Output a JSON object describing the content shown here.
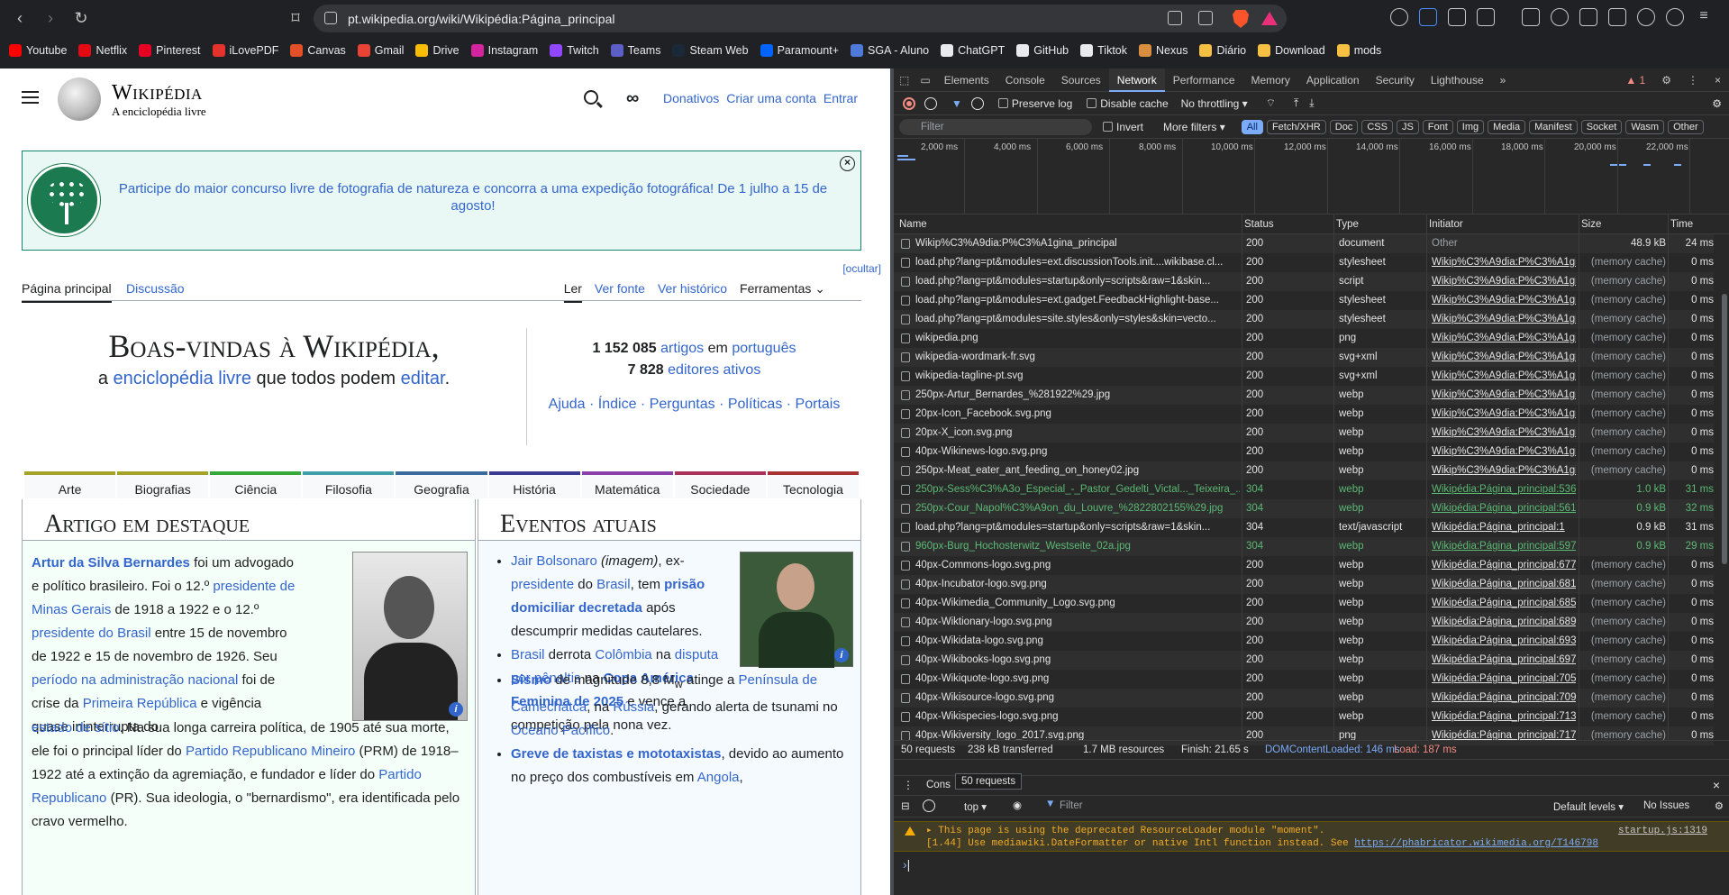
{
  "browser": {
    "url": "pt.wikipedia.org/wiki/Wikipédia:Página_principal",
    "bookmarks": [
      "Youtube",
      "Netflix",
      "Pinterest",
      "iLovePDF",
      "Canvas",
      "Gmail",
      "Drive",
      "Instagram",
      "Twitch",
      "Teams",
      "Steam Web",
      "Paramount+",
      "SGA - Aluno",
      "ChatGPT",
      "GitHub",
      "Tiktok",
      "Nexus",
      "Diário",
      "Download",
      "mods"
    ],
    "bookmark_colors": [
      "#ff0000",
      "#e50914",
      "#e60023",
      "#e5322d",
      "#e34f26",
      "#ea4335",
      "#fbbc04",
      "#d6249f",
      "#9146ff",
      "#5b5fc7",
      "#1b2838",
      "#0064ff",
      "#4f7ad9",
      "#e8eaed",
      "#e8eaed",
      "#e8eaed",
      "#d98f40",
      "#f6c043",
      "#f6c043",
      "#f6c043"
    ]
  },
  "wiki": {
    "wordmark": "Wikipédia",
    "tagline": "A enciclopédia livre",
    "header_links": [
      "Donativos",
      "Criar uma conta",
      "Entrar"
    ],
    "banner": "Participe do maior concurso livre de fotografia de natureza e concorra a uma expedição fotográfica! De 1 julho a 15 de agosto!",
    "hide": "[ocultar]",
    "tabs_left": [
      "Página principal",
      "Discussão"
    ],
    "tabs_right": [
      "Ler",
      "Ver fonte",
      "Ver histórico",
      "Ferramentas"
    ],
    "welcome_title": "Boas-vindas à Wikipédia,",
    "welcome_line": {
      "a": "a ",
      "b": "enciclopédia livre",
      "c": " que todos podem ",
      "d": "editar",
      "e": "."
    },
    "stats": {
      "articles_num": "1 152 085",
      "articles": "artigos",
      "em": "em",
      "lang": "português",
      "editors_num": "7 828",
      "editors": "editores ativos"
    },
    "help_links": "Ajuda · Índice · Perguntas · Políticas · Portais",
    "categories": [
      {
        "name": "Arte",
        "color": "#a3a427"
      },
      {
        "name": "Biografias",
        "color": "#a3a427"
      },
      {
        "name": "Ciência",
        "color": "#36a839"
      },
      {
        "name": "Filosofia",
        "color": "#3f9ea8"
      },
      {
        "name": "Geografia",
        "color": "#3a6b9c"
      },
      {
        "name": "História",
        "color": "#3b3a93"
      },
      {
        "name": "Matemática",
        "color": "#8b3fa8"
      },
      {
        "name": "Sociedade",
        "color": "#a8325a"
      },
      {
        "name": "Tecnologia",
        "color": "#a83232"
      }
    ],
    "featured": {
      "title": "Artigo em destaque",
      "p1": [
        {
          "t": "Artur da Silva Bernardes",
          "s": "lkb"
        },
        {
          "t": " foi um advogado e político brasileiro. Foi o 12.º "
        },
        {
          "t": "presidente de Minas Gerais",
          "s": "lk"
        },
        {
          "t": " de 1918 a 1922 e o 12.º "
        },
        {
          "t": "presidente do Brasil",
          "s": "lk"
        },
        {
          "t": " entre 15 de novembro de 1922 e 15 de novembro de 1926. Seu "
        },
        {
          "t": "período na administração nacional",
          "s": "lk"
        },
        {
          "t": " foi de crise da "
        },
        {
          "t": "Primeira República",
          "s": "lk"
        },
        {
          "t": " e vigência quase ininterrupta do"
        }
      ],
      "p2": [
        {
          "t": "estado de sítio",
          "s": "lk"
        },
        {
          "t": ". Na sua longa carreira política, de 1905 até sua morte, ele foi o principal líder do "
        },
        {
          "t": "Partido Republicano Mineiro",
          "s": "lk"
        },
        {
          "t": " (PRM) de 1918–1922 até a extinção da agremiação, e fundador e líder do "
        },
        {
          "t": "Partido Republicano",
          "s": "lk"
        },
        {
          "t": " (PR). Sua ideologia, o \"bernardismo\", era identificada pelo cravo vermelho."
        }
      ]
    },
    "events": {
      "title": "Eventos atuais",
      "items": [
        [
          {
            "t": "Jair Bolsonaro",
            "s": "lk"
          },
          {
            "t": " (imagem)",
            "s": "it"
          },
          {
            "t": ", ex-"
          },
          {
            "t": "presidente",
            "s": "lk"
          },
          {
            "t": " do "
          },
          {
            "t": "Brasil",
            "s": "lk"
          },
          {
            "t": ", tem "
          },
          {
            "t": "prisão domiciliar decretada",
            "s": "lkb"
          },
          {
            "t": " após descumprir medidas cautelares."
          }
        ],
        [
          {
            "t": "Brasil",
            "s": "lk"
          },
          {
            "t": " derrota "
          },
          {
            "t": "Colômbia",
            "s": "lk"
          },
          {
            "t": " na "
          },
          {
            "t": "disputa por pênaltis",
            "s": "lk"
          },
          {
            "t": " na "
          },
          {
            "t": "Copa América Feminina de 2025",
            "s": "lkb"
          },
          {
            "t": " e vence a competição pela nona vez."
          }
        ]
      ],
      "items2": [
        [
          {
            "t": "Sismo",
            "s": "lkb"
          },
          {
            "t": " de magnitude 8,8 M"
          },
          {
            "t": "w",
            "s": "sub"
          },
          {
            "t": " atinge a "
          },
          {
            "t": "Península de Camechátca",
            "s": "lk"
          },
          {
            "t": ", na "
          },
          {
            "t": "Rússia",
            "s": "lk"
          },
          {
            "t": ", gerando alerta de tsunami no "
          },
          {
            "t": "Oceano Pacífico",
            "s": "lk"
          },
          {
            "t": "."
          }
        ],
        [
          {
            "t": "Greve de taxistas e mototaxistas",
            "s": "lkb"
          },
          {
            "t": ", devido ao aumento no preço dos combustíveis em "
          },
          {
            "t": "Angola",
            "s": "lk"
          },
          {
            "t": ","
          }
        ]
      ]
    }
  },
  "devtools": {
    "tabs": [
      "Elements",
      "Console",
      "Sources",
      "Network",
      "Performance",
      "Memory",
      "Application",
      "Security",
      "Lighthouse"
    ],
    "issues_count": "1",
    "toolbar": {
      "preserve_log": "Preserve log",
      "disable_cache": "Disable cache",
      "throttling": "No throttling"
    },
    "filter": {
      "placeholder": "Filter",
      "invert": "Invert",
      "more_filters": "More filters"
    },
    "types": [
      "All",
      "Fetch/XHR",
      "Doc",
      "CSS",
      "JS",
      "Font",
      "Img",
      "Media",
      "Manifest",
      "Socket",
      "Wasm",
      "Other"
    ],
    "ticks": [
      "2,000 ms",
      "4,000 ms",
      "6,000 ms",
      "8,000 ms",
      "10,000 ms",
      "12,000 ms",
      "14,000 ms",
      "16,000 ms",
      "18,000 ms",
      "20,000 ms",
      "22,000 ms"
    ],
    "columns": [
      "Name",
      "Status",
      "Type",
      "Initiator",
      "Size",
      "Time"
    ],
    "rows": [
      [
        "Wikip%C3%A9dia:P%C3%A1gina_principal",
        "200",
        "document",
        "Other",
        "48.9 kB",
        "24 ms",
        ""
      ],
      [
        "load.php?lang=pt&modules=ext.discussionTools.init....wikibase.cl...",
        "200",
        "stylesheet",
        "Wikip%C3%A9dia:P%C3%A1gi",
        "(memory cache)",
        "0 ms",
        ""
      ],
      [
        "load.php?lang=pt&modules=startup&only=scripts&raw=1&skin...",
        "200",
        "script",
        "Wikip%C3%A9dia:P%C3%A1gi",
        "(memory cache)",
        "0 ms",
        ""
      ],
      [
        "load.php?lang=pt&modules=ext.gadget.FeedbackHighlight-base...",
        "200",
        "stylesheet",
        "Wikip%C3%A9dia:P%C3%A1gi",
        "(memory cache)",
        "0 ms",
        ""
      ],
      [
        "load.php?lang=pt&modules=site.styles&only=styles&skin=vecto...",
        "200",
        "stylesheet",
        "Wikip%C3%A9dia:P%C3%A1gi",
        "(memory cache)",
        "0 ms",
        ""
      ],
      [
        "wikipedia.png",
        "200",
        "png",
        "Wikip%C3%A9dia:P%C3%A1gi",
        "(memory cache)",
        "0 ms",
        ""
      ],
      [
        "wikipedia-wordmark-fr.svg",
        "200",
        "svg+xml",
        "Wikip%C3%A9dia:P%C3%A1gi",
        "(memory cache)",
        "0 ms",
        ""
      ],
      [
        "wikipedia-tagline-pt.svg",
        "200",
        "svg+xml",
        "Wikip%C3%A9dia:P%C3%A1gi",
        "(memory cache)",
        "0 ms",
        ""
      ],
      [
        "250px-Artur_Bernardes_%281922%29.jpg",
        "200",
        "webp",
        "Wikip%C3%A9dia:P%C3%A1gi",
        "(memory cache)",
        "0 ms",
        ""
      ],
      [
        "20px-Icon_Facebook.svg.png",
        "200",
        "webp",
        "Wikip%C3%A9dia:P%C3%A1gi",
        "(memory cache)",
        "0 ms",
        ""
      ],
      [
        "20px-X_icon.svg.png",
        "200",
        "webp",
        "Wikip%C3%A9dia:P%C3%A1gi",
        "(memory cache)",
        "0 ms",
        ""
      ],
      [
        "40px-Wikinews-logo.svg.png",
        "200",
        "webp",
        "Wikip%C3%A9dia:P%C3%A1gi",
        "(memory cache)",
        "0 ms",
        ""
      ],
      [
        "250px-Meat_eater_ant_feeding_on_honey02.jpg",
        "200",
        "webp",
        "Wikip%C3%A9dia:P%C3%A1gi",
        "(memory cache)",
        "0 ms",
        ""
      ],
      [
        "250px-Sess%C3%A3o_Especial_-_Pastor_Gedelti_Victal..._Teixeira_...",
        "304",
        "webp",
        "Wikipédia:Página_principal:536",
        "1.0 kB",
        "31 ms",
        "green"
      ],
      [
        "250px-Cour_Napol%C3%A9on_du_Louvre_%2822802155%29.jpg",
        "304",
        "webp",
        "Wikipédia:Página_principal:561",
        "0.9 kB",
        "32 ms",
        "green"
      ],
      [
        "load.php?lang=pt&modules=startup&only=scripts&raw=1&skin...",
        "304",
        "text/javascript",
        "Wikipédia:Página_principal:1",
        "0.9 kB",
        "31 ms",
        ""
      ],
      [
        "960px-Burg_Hochosterwitz_Westseite_02a.jpg",
        "304",
        "webp",
        "Wikipédia:Página_principal:597",
        "0.9 kB",
        "29 ms",
        "green"
      ],
      [
        "40px-Commons-logo.svg.png",
        "200",
        "webp",
        "Wikipédia:Página_principal:677",
        "(memory cache)",
        "0 ms",
        ""
      ],
      [
        "40px-Incubator-logo.svg.png",
        "200",
        "webp",
        "Wikipédia:Página_principal:681",
        "(memory cache)",
        "0 ms",
        ""
      ],
      [
        "40px-Wikimedia_Community_Logo.svg.png",
        "200",
        "webp",
        "Wikipédia:Página_principal:685",
        "(memory cache)",
        "0 ms",
        ""
      ],
      [
        "40px-Wiktionary-logo.svg.png",
        "200",
        "webp",
        "Wikipédia:Página_principal:689",
        "(memory cache)",
        "0 ms",
        ""
      ],
      [
        "40px-Wikidata-logo.svg.png",
        "200",
        "webp",
        "Wikipédia:Página_principal:693",
        "(memory cache)",
        "0 ms",
        ""
      ],
      [
        "40px-Wikibooks-logo.svg.png",
        "200",
        "webp",
        "Wikipédia:Página_principal:697",
        "(memory cache)",
        "0 ms",
        ""
      ],
      [
        "40px-Wikiquote-logo.svg.png",
        "200",
        "webp",
        "Wikipédia:Página_principal:705",
        "(memory cache)",
        "0 ms",
        ""
      ],
      [
        "40px-Wikisource-logo.svg.png",
        "200",
        "webp",
        "Wikipédia:Página_principal:709",
        "(memory cache)",
        "0 ms",
        ""
      ],
      [
        "40px-Wikispecies-logo.svg.png",
        "200",
        "webp",
        "Wikipédia:Página_principal:713",
        "(memory cache)",
        "0 ms",
        ""
      ],
      [
        "40px-Wikiversity_logo_2017.svg.png",
        "200",
        "png",
        "Wikipédia:Página_principal:717",
        "(memory cache)",
        "0 ms",
        ""
      ]
    ],
    "summary": [
      "50 requests",
      "238 kB transferred",
      "1.7 MB resources",
      "Finish: 21.65 s",
      "DOMContentLoaded: 146 ms",
      "Load: 187 ms"
    ],
    "console": {
      "tab": "Cons",
      "tooltip": "50 requests",
      "context": "top",
      "filter": "Filter",
      "levels": "Default levels",
      "issues": "No Issues",
      "warn_line1": "▸ This page is using the deprecated ResourceLoader module \"moment\".",
      "warn_line2a": "[1.44] Use mediawiki.DateFormatter or native Intl function instead. See ",
      "warn_link": "https://phabricator.wikimedia.org/T146798",
      "warn_src": "startup.js:1319",
      "prompt": "›"
    }
  }
}
